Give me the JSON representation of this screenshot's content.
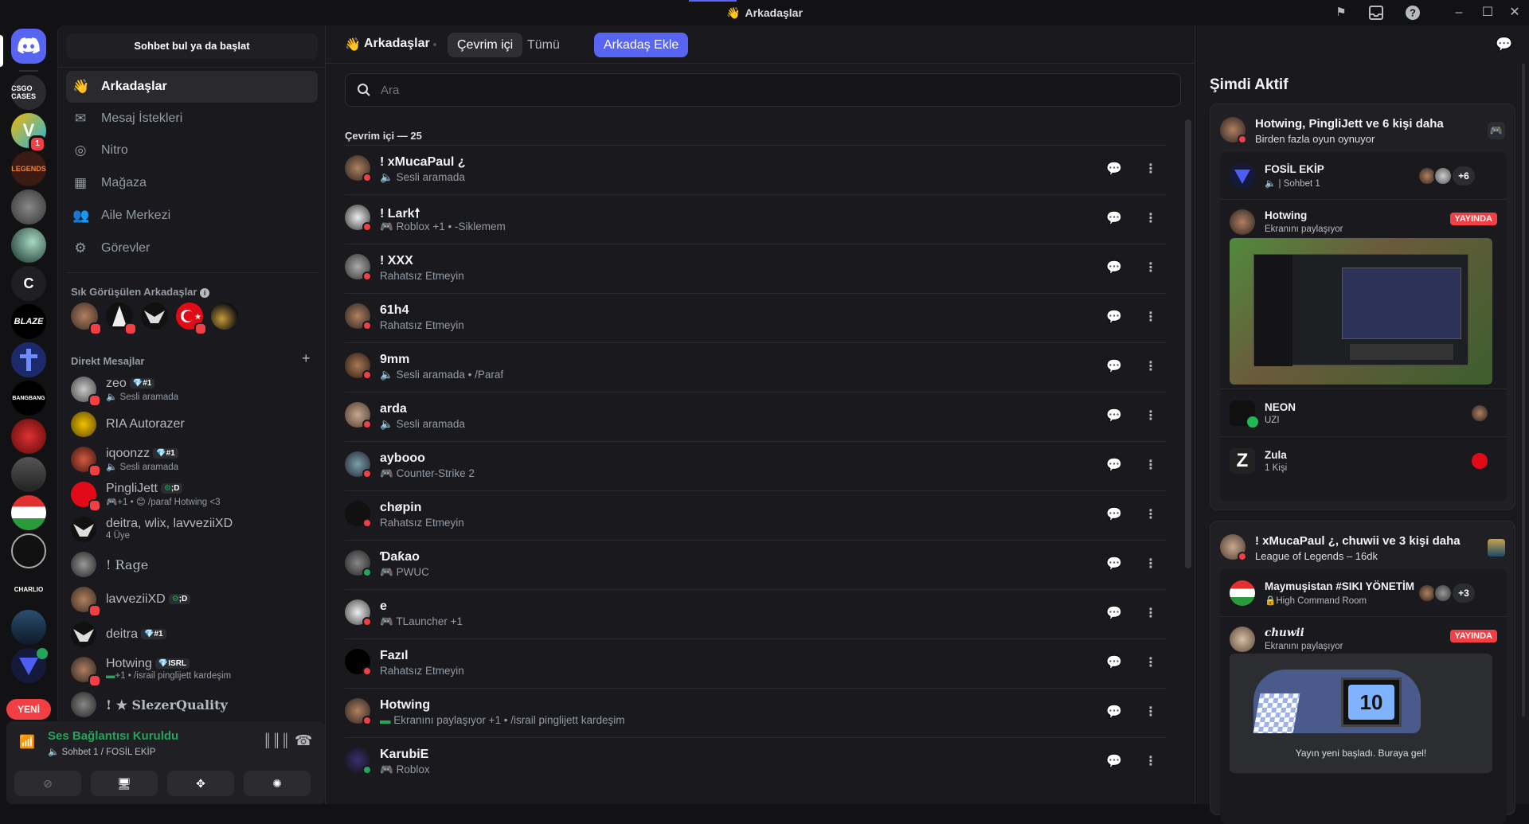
{
  "window": {
    "title": "Arkadaşlar"
  },
  "rail": {
    "guilds": [
      "CSGO CASES",
      "V",
      "LEGENDS",
      "",
      "",
      "C",
      "BLAZE",
      "",
      "BANGBANG",
      "",
      "",
      "",
      "",
      "CHARLIO",
      "",
      ""
    ],
    "badge_1": "1",
    "new_label": "YENİ"
  },
  "sidebar": {
    "search_label": "Sohbet bul ya da başlat",
    "nav": [
      {
        "label": "Arkadaşlar",
        "icon": "friends-icon"
      },
      {
        "label": "Mesaj İstekleri",
        "icon": "mail-icon"
      },
      {
        "label": "Nitro",
        "icon": "nitro-icon"
      },
      {
        "label": "Mağaza",
        "icon": "shop-icon"
      },
      {
        "label": "Aile Merkezi",
        "icon": "family-icon"
      },
      {
        "label": "Görevler",
        "icon": "quests-icon"
      }
    ],
    "fav_header": "Sık Görüşülen Arkadaşlar",
    "dm_header": "Direkt Mesajlar",
    "dm_add": "+",
    "dms": [
      {
        "name": "zeo",
        "tag": "#1",
        "status": "Sesli aramada"
      },
      {
        "name": "RIA Autorazer",
        "tag": "",
        "status": ""
      },
      {
        "name": "iqoonzz",
        "tag": "#1",
        "status": "Sesli aramada"
      },
      {
        "name": "PingliJett",
        "tag": ";D",
        "status": "+1 • 😊 /paraf Hotwing <3"
      },
      {
        "name": "deitra, wlix, lavveziiXD",
        "tag": "",
        "status": "4 Üye"
      },
      {
        "name": "! Rage",
        "tag": "",
        "status": ""
      },
      {
        "name": "lavveziiXD",
        "tag": ";D",
        "status": ""
      },
      {
        "name": "deitra",
        "tag": "#1",
        "status": ""
      },
      {
        "name": "Hotwing",
        "tag": "ISRL",
        "status": "+1 • /israil pinglijett kardeşim"
      },
      {
        "name": "! ★ SlezerQuality",
        "tag": "",
        "status": ""
      }
    ]
  },
  "voice": {
    "status": "Ses Bağlantısı Kuruldu",
    "channel": "Sohbet 1 / FOSİL EKİP"
  },
  "main": {
    "title": "Arkadaşlar",
    "tabs": [
      "Çevrim içi",
      "Tümü",
      "Arkadaş Ekle"
    ],
    "search_placeholder": "Ara",
    "online_header": "Çevrim içi — 25",
    "friends": [
      {
        "name": "! xMucaPaul ¿",
        "status": "Sesli aramada",
        "state": "dnd"
      },
      {
        "name": "! Lark🠕",
        "status": "Roblox +1 • -Siklemem",
        "state": "dnd"
      },
      {
        "name": "! XXX",
        "status": "Rahatsız Etmeyin",
        "state": "dnd"
      },
      {
        "name": "61h4",
        "status": "Rahatsız Etmeyin",
        "state": "dnd"
      },
      {
        "name": "9mm",
        "status": "Sesli aramada • /Paraf",
        "state": "dnd"
      },
      {
        "name": "arda",
        "status": "Sesli aramada",
        "state": "dnd"
      },
      {
        "name": "aybooo",
        "status": "Counter-Strike 2",
        "state": "dnd"
      },
      {
        "name": "chøpin",
        "status": "Rahatsız Etmeyin",
        "state": "dnd"
      },
      {
        "name": "Ɗaƙao",
        "status": "PWUC",
        "state": "on"
      },
      {
        "name": "e",
        "status": "TLauncher +1",
        "state": "dnd"
      },
      {
        "name": "Fazıl",
        "status": "Rahatsız Etmeyin",
        "state": "dnd"
      },
      {
        "name": "Hotwing",
        "status": "Ekranını paylaşıyor +1 • /israil pinglijett kardeşim",
        "state": "dnd"
      },
      {
        "name": "KarubiE",
        "status": "Roblox",
        "state": "on"
      }
    ]
  },
  "right": {
    "title": "Şimdi Aktif",
    "card1": {
      "title": "Hotwing, PingliJett ve 6 kişi daha",
      "subtitle": "Birden fazla oyun oynuyor",
      "rows": [
        {
          "name": "FOSİL EKİP",
          "status": "| Sohbet 1",
          "extra": "+6"
        },
        {
          "name": "Hotwing",
          "status": "Ekranını paylaşıyor",
          "live": "YAYINDA"
        },
        {
          "name": "NEON",
          "status": "UZI"
        },
        {
          "name": "Zula",
          "status": "1 Kişi"
        }
      ]
    },
    "card2": {
      "title": "! xMucaPaul ¿, chuwii ve 3 kişi daha",
      "subtitle": "League of Legends – 16dk",
      "rows": [
        {
          "name": "Maymuşistan #SIKI YÖNETİM",
          "status": "High Command Room",
          "extra": "+3"
        },
        {
          "name": "chuwii",
          "status": "Ekranını paylaşıyor",
          "live": "YAYINDA"
        }
      ],
      "stream_caption": "Yayın yeni başladı. Buraya gel!",
      "tv_number": "10"
    }
  },
  "colors": {
    "accent": "#5865f2",
    "dnd": "#f23f43",
    "online": "#23a55a",
    "voice_green": "#23a55a"
  }
}
